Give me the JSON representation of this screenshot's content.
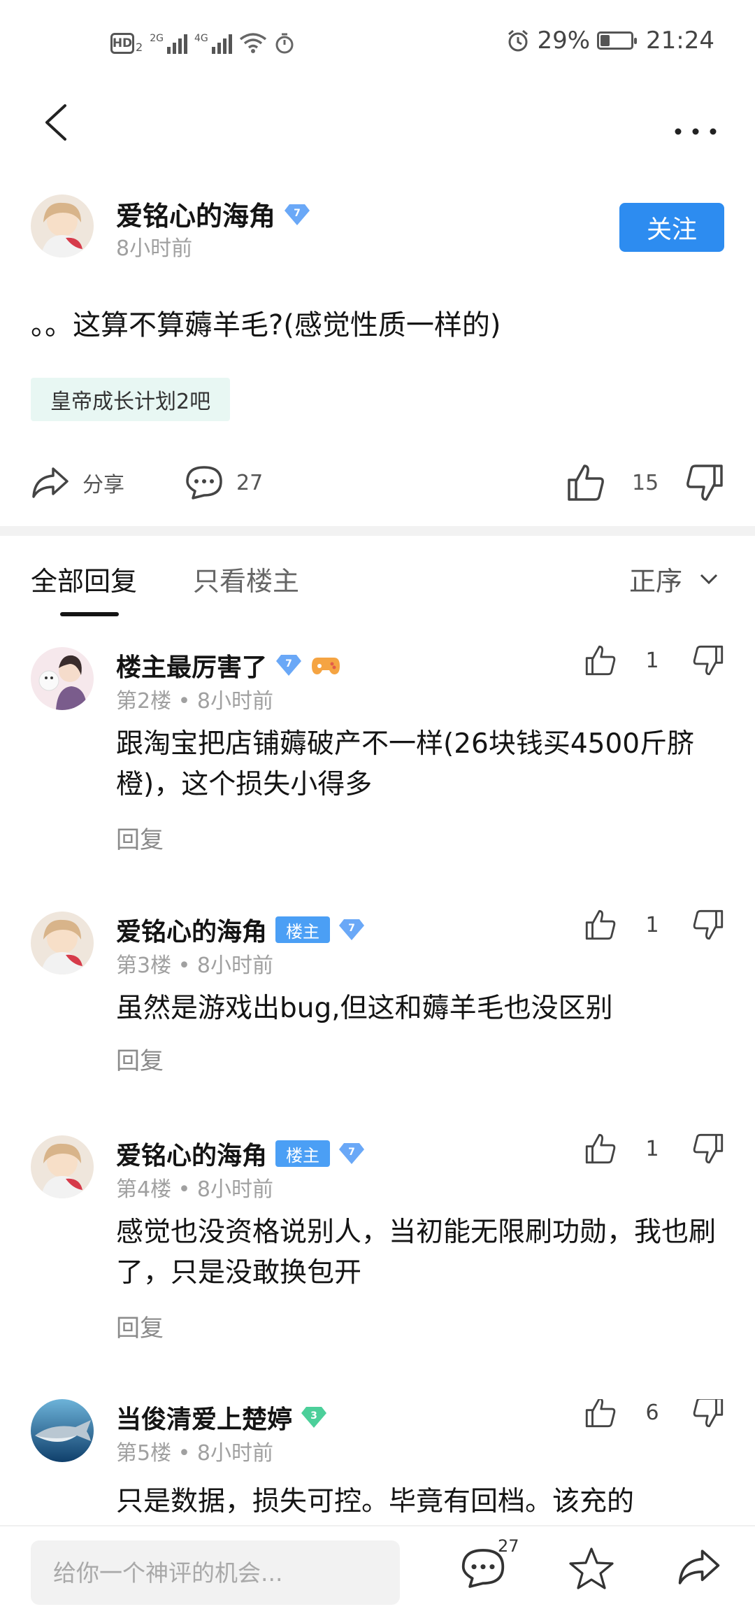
{
  "status_bar": {
    "network_hd": "HD",
    "network_hd_sub": "2",
    "sim1_label": "2G",
    "sim2_label": "4G",
    "battery_percent": "29%",
    "battery_level": 0.29,
    "time": "21:24"
  },
  "nav": {
    "back_icon": "chevron-left-icon",
    "more_icon": "more-horizontal-icon"
  },
  "post": {
    "author": "爱铭心的海角",
    "author_level": "7",
    "time": "8小时前",
    "follow_label": "关注",
    "text": "。。这算不算薅羊毛?(感觉性质一样的)",
    "topic": "皇帝成长计划2吧",
    "share_label": "分享",
    "comment_count": "27",
    "like_count": "15"
  },
  "tabs": {
    "all": "全部回复",
    "owner_only": "只看楼主",
    "sort": "正序"
  },
  "replies": [
    {
      "name": "楼主最厉害了",
      "level": "7",
      "floor": "第2楼",
      "time": "8小时前",
      "likes": "1",
      "body": "跟淘宝把店铺薅破产不一样(26块钱买4500斤脐橙)，这个损失小得多",
      "reply_label": "回复"
    },
    {
      "name": "爱铭心的海角",
      "owner_badge": "楼主",
      "level": "7",
      "floor": "第3楼",
      "time": "8小时前",
      "likes": "1",
      "body": "虽然是游戏出bug,但这和薅羊毛也没区别",
      "reply_label": "回复"
    },
    {
      "name": "爱铭心的海角",
      "owner_badge": "楼主",
      "level": "7",
      "floor": "第4楼",
      "time": "8小时前",
      "likes": "1",
      "body": "感觉也没资格说别人，当初能无限刷功勋，我也刷了，只是没敢换包开",
      "reply_label": "回复"
    },
    {
      "name": "当俊清爱上楚婷",
      "level": "3",
      "floor": "第5楼",
      "time": "8小时前",
      "likes": "6",
      "body": "只是数据，损失可控。毕竟有回档。该充的"
    }
  ],
  "bottom_bar": {
    "input_placeholder": "给你一个神评的机会...",
    "comment_count": "27"
  },
  "colors": {
    "accent": "#2d8cf0",
    "owner_badge": "#4b9ff5",
    "level_badge": "#6aa8f7",
    "level_badge_green": "#4ccf9a",
    "topic_bg": "#e8f7f3"
  }
}
